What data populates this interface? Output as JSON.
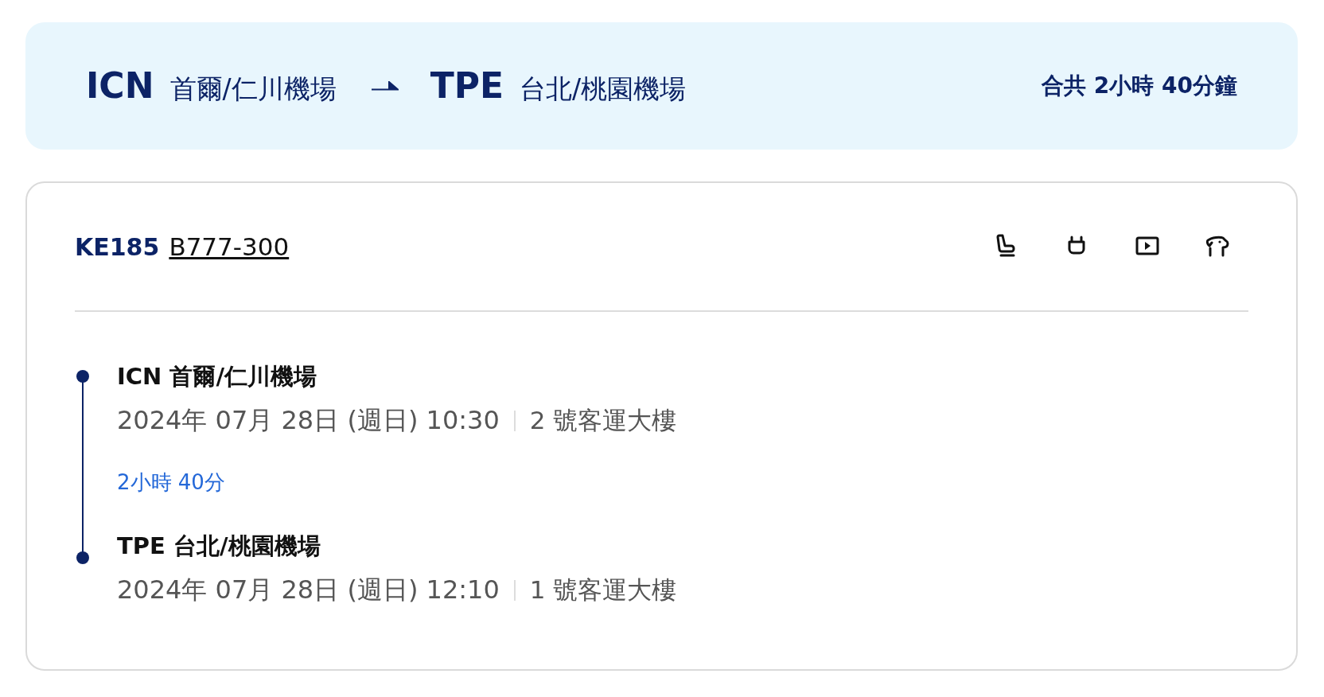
{
  "route": {
    "origin": {
      "code": "ICN",
      "name": "首爾/仁川機場"
    },
    "destination": {
      "code": "TPE",
      "name": "台北/桃園機場"
    },
    "total": "合共 2小時 40分鐘"
  },
  "flight": {
    "number": "KE185",
    "aircraft": "B777-300",
    "amenities": [
      {
        "kind": "seat"
      },
      {
        "kind": "power"
      },
      {
        "kind": "video"
      },
      {
        "kind": "pet"
      }
    ]
  },
  "stops": [
    {
      "station": "ICN 首爾/仁川機場",
      "datetime": "2024年 07月 28日 (週日) 10:30",
      "terminal": "2 號客運大樓"
    },
    {
      "station": "TPE 台北/桃園機場",
      "datetime": "2024年 07月 28日 (週日) 12:10",
      "terminal": "1 號客運大樓"
    }
  ],
  "duration": "2小時 40分"
}
